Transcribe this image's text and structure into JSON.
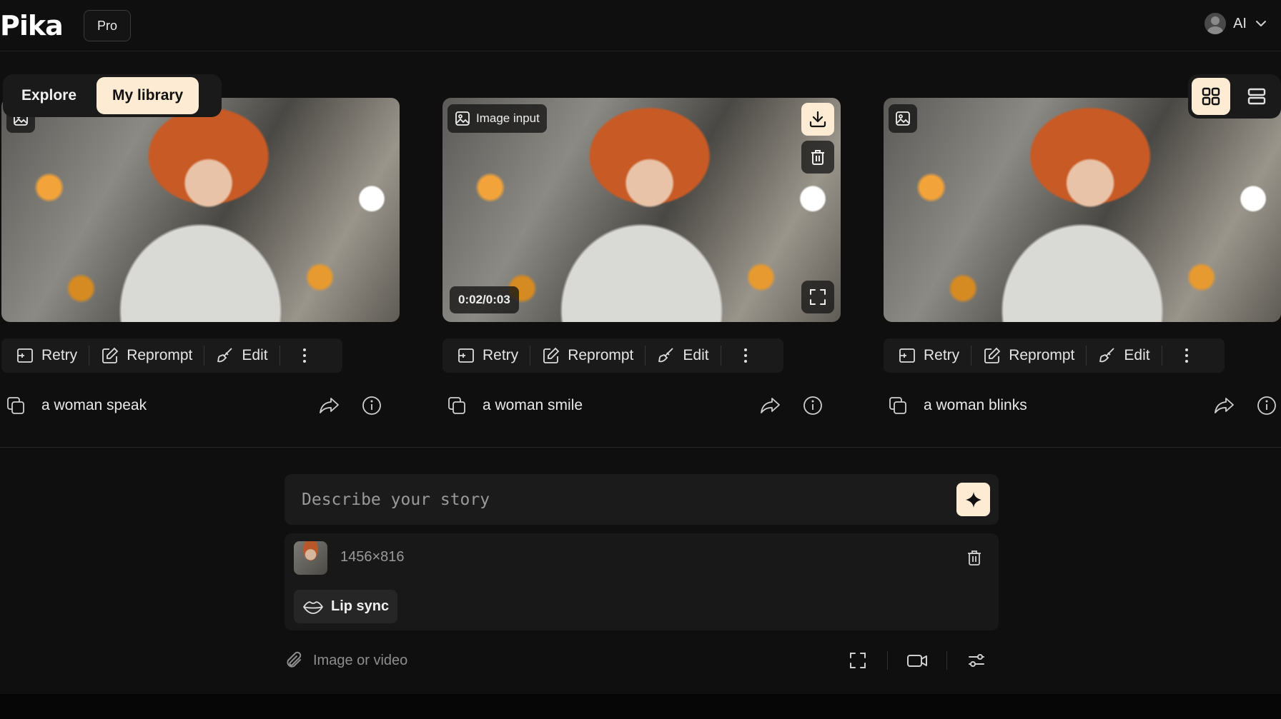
{
  "header": {
    "logo": "Pika",
    "plan_badge": "Pro",
    "user_name": "AI"
  },
  "tabs": [
    {
      "label": "Explore",
      "active": false
    },
    {
      "label": "My library",
      "active": true
    }
  ],
  "view_modes": [
    {
      "icon": "grid-icon",
      "active": true
    },
    {
      "icon": "list-icon",
      "active": false
    }
  ],
  "actions": {
    "retry": "Retry",
    "reprompt": "Reprompt",
    "edit": "Edit"
  },
  "cards": [
    {
      "prompt": "a woman speak"
    },
    {
      "prompt": "a woman smile",
      "image_input_label": "Image input",
      "time": "0:02/0:03"
    },
    {
      "prompt": "a woman blinks"
    }
  ],
  "composer": {
    "placeholder": "Describe your story",
    "attachment_size": "1456×816",
    "lip_sync_label": "Lip sync",
    "attach_label": "Image or video"
  },
  "colors": {
    "accent": "#fdebd3",
    "background": "#0f0f0f",
    "panel": "#1a1a1a"
  }
}
